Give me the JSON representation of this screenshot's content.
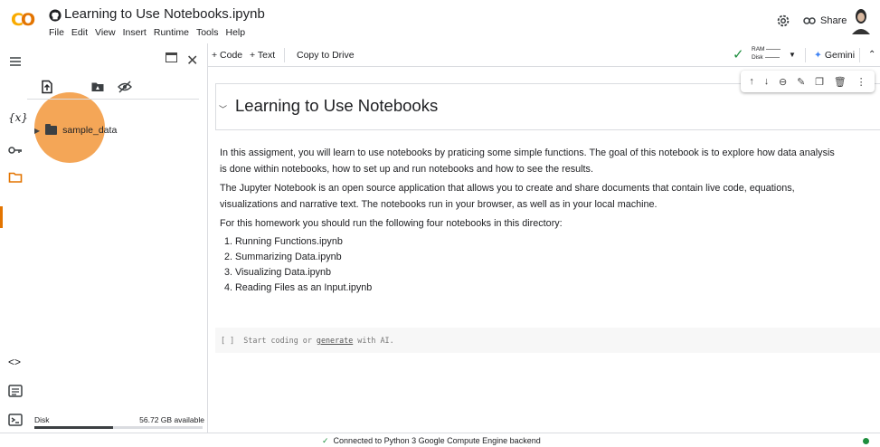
{
  "logo": {
    "text": "CO"
  },
  "title": "Learning to Use Notebooks.ipynb",
  "menu": [
    "File",
    "Edit",
    "View",
    "Insert",
    "Runtime",
    "Tools",
    "Help"
  ],
  "header": {
    "share_label": "Share"
  },
  "toolbar": {
    "add_code": "+ Code",
    "add_text": "+ Text",
    "copy_to_drive": "Copy to Drive",
    "ram_label": "RAM",
    "disk_label": "Disk",
    "gemini_label": "Gemini"
  },
  "file_tree": [
    {
      "name": "sample_data",
      "type": "folder"
    }
  ],
  "disk": {
    "label": "Disk",
    "available": "56.72 GB available",
    "used_fraction": 0.47
  },
  "notebook": {
    "heading": "Learning to Use Notebooks",
    "paragraphs": [
      "In this assigment, you will learn to use notebooks by praticing some simple functions. The goal of this notebook is to explore how data analysis is done within notebooks, how to set up and run notebooks and how to see the results.",
      "The Jupyter Notebook is an open source application that allows you to create and share documents that contain live code, equations, visualizations and narrative text. The notebooks run in your browser, as well as in your local machine.",
      "For this homework you should run the following four notebooks in this directory:"
    ],
    "list": [
      "Running Functions.ipynb",
      "Summarizing Data.ipynb",
      "Visualizing Data.ipynb",
      "Reading Files as an Input.ipynb"
    ],
    "code_cell": {
      "prompt": "[ ]",
      "before": "Start coding or ",
      "link": "generate",
      "after": " with AI."
    }
  },
  "status": {
    "message": "Connected to Python 3 Google Compute Engine backend"
  },
  "colors": {
    "accent": "#e37400",
    "highlight": "#f39c45",
    "connected": "#1e8e3e"
  }
}
